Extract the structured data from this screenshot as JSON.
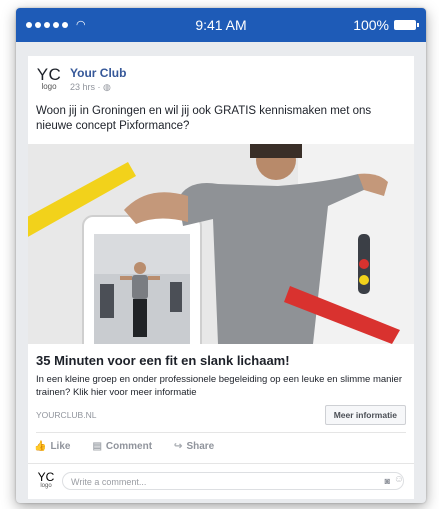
{
  "status_bar": {
    "time": "9:41 AM",
    "battery": "100%"
  },
  "post": {
    "logo_text": "YC",
    "logo_sub": "logo",
    "page_name": "Your Club",
    "timestamp": "23 hrs · ◍",
    "text": "Woon jij in Groningen en wil jij ook GRATIS kennismaken met ons nieuwe concept Pixformance?",
    "link_title": "35 Minuten voor een fit en slank lichaam!",
    "link_description": "In een kleine groep en onder professionele begeleiding op een leuke en slimme manier trainen? Klik hier voor meer informatie",
    "link_domain": "YOURCLUB.NL",
    "cta_label": "Meer informatie"
  },
  "actions": {
    "like": "Like",
    "comment": "Comment",
    "share": "Share"
  },
  "comment": {
    "placeholder": "Write a comment..."
  },
  "colors": {
    "status_bar": "#1e5bb7",
    "link_blue": "#365899",
    "accent_yellow": "#f2d21b",
    "accent_red": "#d9322f"
  }
}
